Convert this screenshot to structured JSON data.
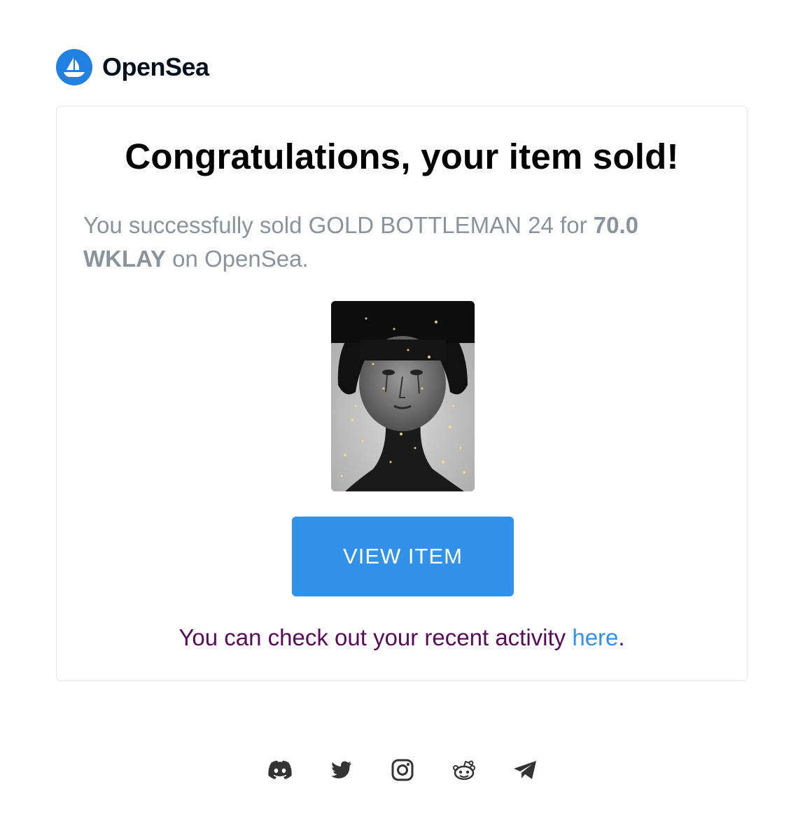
{
  "brand": {
    "name": "OpenSea",
    "logo_color": "#2081e2",
    "logo_icon": "sailboat-icon"
  },
  "email": {
    "headline": "Congratulations, your item sold!",
    "message_prefix": "You successfully sold GOLD BOTTLEMAN 24 for ",
    "price": "70.0 WKLAY",
    "message_suffix": " on OpenSea.",
    "item_image": "nft-artwork: dark-haired figure with pale face and gold speckles",
    "button_label": "VIEW ITEM",
    "button_color": "#3291e9",
    "activity_text": "You can check out your recent activity ",
    "activity_link": "here",
    "activity_end": "."
  },
  "social": [
    {
      "icon": "discord-icon"
    },
    {
      "icon": "twitter-icon"
    },
    {
      "icon": "instagram-icon"
    },
    {
      "icon": "reddit-icon"
    },
    {
      "icon": "telegram-icon"
    }
  ]
}
